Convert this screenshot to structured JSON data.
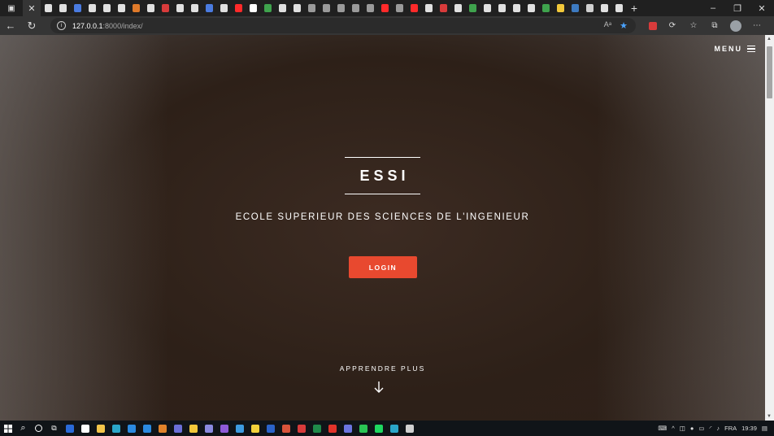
{
  "browser": {
    "url_host": "127.0.0.1",
    "url_path": ":8000/index/",
    "read_aloud_label": "Aᵃ",
    "tabs": [
      {
        "icon": "page-icon",
        "color": "#e0e0e0"
      },
      {
        "icon": "page-icon",
        "color": "#e0e0e0"
      },
      {
        "icon": "translate-icon",
        "color": "#4a7be0"
      },
      {
        "icon": "page-icon",
        "color": "#e0e0e0"
      },
      {
        "icon": "page-icon",
        "color": "#e0e0e0"
      },
      {
        "icon": "search-icon",
        "color": "#e0e0e0"
      },
      {
        "icon": "app-icon",
        "color": "#e07a2a"
      },
      {
        "icon": "page-icon",
        "color": "#e0e0e0"
      },
      {
        "icon": "pdf-icon",
        "color": "#d83b3b"
      },
      {
        "icon": "search-icon",
        "color": "#e0e0e0"
      },
      {
        "icon": "search-icon",
        "color": "#e0e0e0"
      },
      {
        "icon": "translate-icon",
        "color": "#4a7be0"
      },
      {
        "icon": "audio-icon",
        "color": "#e0e0e0"
      },
      {
        "icon": "youtube-icon",
        "color": "#ff2a2a"
      },
      {
        "icon": "wikipedia-icon",
        "color": "#ffffff"
      },
      {
        "icon": "app-icon",
        "color": "#3fa34d"
      },
      {
        "icon": "page-icon",
        "color": "#e0e0e0"
      },
      {
        "icon": "page-icon",
        "color": "#e0e0e0"
      },
      {
        "icon": "page-icon",
        "color": "#9a9a9a"
      },
      {
        "icon": "page-icon",
        "color": "#9a9a9a"
      },
      {
        "icon": "search-icon",
        "color": "#9a9a9a"
      },
      {
        "icon": "page-icon",
        "color": "#9a9a9a"
      },
      {
        "icon": "page-icon",
        "color": "#9a9a9a"
      },
      {
        "icon": "youtube-icon",
        "color": "#ff2a2a"
      },
      {
        "icon": "search-icon",
        "color": "#9a9a9a"
      },
      {
        "icon": "youtube-icon",
        "color": "#ff2a2a"
      },
      {
        "icon": "search-icon",
        "color": "#e0e0e0"
      },
      {
        "icon": "app-icon",
        "color": "#d83b3b"
      },
      {
        "icon": "search-icon",
        "color": "#e0e0e0"
      },
      {
        "icon": "app-icon",
        "color": "#3fa34d"
      },
      {
        "icon": "search-icon",
        "color": "#e0e0e0"
      },
      {
        "icon": "search-icon",
        "color": "#e0e0e0"
      },
      {
        "icon": "search-icon",
        "color": "#e0e0e0"
      },
      {
        "icon": "search-icon",
        "color": "#e0e0e0"
      },
      {
        "icon": "app-icon",
        "color": "#3fa34d"
      },
      {
        "icon": "python-icon",
        "color": "#f2c83a"
      },
      {
        "icon": "python-icon",
        "color": "#3d7ac0"
      },
      {
        "icon": "grid-icon",
        "color": "#cfcfcf"
      },
      {
        "icon": "medium-icon",
        "color": "#e0e0e0"
      },
      {
        "icon": "medium-icon",
        "color": "#e0e0e0"
      }
    ]
  },
  "header": {
    "menu_label": "MENU"
  },
  "hero": {
    "brand": "ESSI",
    "subtitle": "ECOLE SUPERIEUR DES SCIENCES DE L'INGENIEUR",
    "login_label": "LOGIN",
    "learn_more_label": "APPRENDRE PLUS"
  },
  "taskbar": {
    "apps": [
      {
        "icon": "shield-icon",
        "color": "#2a6ad8"
      },
      {
        "icon": "github-icon",
        "color": "#ffffff"
      },
      {
        "icon": "folder-icon",
        "color": "#f3c54a"
      },
      {
        "icon": "edge-icon",
        "color": "#2aa6c9"
      },
      {
        "icon": "vscode-icon",
        "color": "#2b8ae0"
      },
      {
        "icon": "mail-icon",
        "color": "#2b8ae0"
      },
      {
        "icon": "app-icon",
        "color": "#e0822a"
      },
      {
        "icon": "teams-icon",
        "color": "#6b6fd8"
      },
      {
        "icon": "app-icon",
        "color": "#f2c83a"
      },
      {
        "icon": "app-icon",
        "color": "#8a8adf"
      },
      {
        "icon": "visualstudio-icon",
        "color": "#8e5ad8"
      },
      {
        "icon": "chrome-icon",
        "color": "#3d9be0"
      },
      {
        "icon": "app-icon",
        "color": "#f2d13a"
      },
      {
        "icon": "word-icon",
        "color": "#2b63c9"
      },
      {
        "icon": "app-icon",
        "color": "#d8533a"
      },
      {
        "icon": "acrobat-icon",
        "color": "#d83b3b"
      },
      {
        "icon": "excel-icon",
        "color": "#1f8a4a"
      },
      {
        "icon": "app-icon",
        "color": "#e0332a"
      },
      {
        "icon": "discord-icon",
        "color": "#6b75e0"
      },
      {
        "icon": "whatsapp-icon",
        "color": "#2ac454"
      },
      {
        "icon": "spotify-icon",
        "color": "#1ed760"
      },
      {
        "icon": "app-icon",
        "color": "#2aa6c9"
      },
      {
        "icon": "app-icon",
        "color": "#d0d0d0"
      }
    ],
    "language": "FRA",
    "time": "19:39"
  }
}
